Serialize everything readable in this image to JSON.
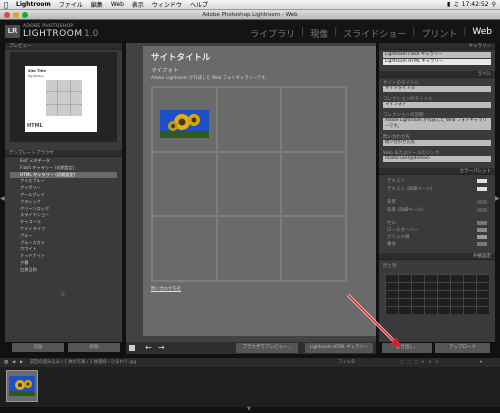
{
  "menubar": {
    "app": "Lightroom",
    "items": [
      "ファイル",
      "編集",
      "Web",
      "表示",
      "ウィンドウ",
      "ヘルプ"
    ],
    "time": "17:42:52"
  },
  "window": {
    "title": "Adobe Photoshop Lightroom - Web"
  },
  "identity": {
    "badge": "LR",
    "adobe": "ADOBE PHOTOSHOP",
    "name": "LIGHTROOM",
    "version": "1.0"
  },
  "modules": [
    "ライブラリ",
    "現像",
    "スライドショー",
    "プリント",
    "Web"
  ],
  "left": {
    "preview_header": "プレビュー",
    "preview_html": "HTML",
    "preview_title": "Site Title",
    "preview_sub": "My Photos",
    "templates_header": "テンプレートブラウザ",
    "templates": [
      "Exif メタデータ",
      "Flash ギャラリー (初期設定)",
      "HTML ギャラリー (初期設定)",
      "アイスブルー",
      "アイボリー",
      "アールグレイ",
      "クラシック",
      "グリーンロック",
      "スライドショー",
      "チャコール",
      "ナイトライフ",
      "ブルー",
      "ブルースカイ",
      "ホワイト",
      "ミッドナイト",
      "夕暮",
      "白黒日和"
    ],
    "selected_template": "HTML ギャラリー (初期設定)",
    "btn_preview": "追加",
    "btn_remove": "削除"
  },
  "center": {
    "site_title": "サイトタイトル",
    "collection_title": "マイフォト",
    "collection_desc": "Adobe Lightroom が作成した Web フォトギャラリーです。",
    "contact": "問い合わせ先名",
    "btn_browser": "ブラウザでプレビュー...",
    "gallery_select": "Lightroom HTML ギャラリー"
  },
  "right": {
    "gallery_header": "ギャラリー",
    "engines": [
      "Lightroom Flash ギャラリー",
      "Lightroom HTML ギャラリー"
    ],
    "labels_header": "ラベル",
    "fields": [
      {
        "label": "サイトのタイトル",
        "value": "サイトタイトル"
      },
      {
        "label": "コレクションのタイトル",
        "value": "マイフォト"
      },
      {
        "label": "コレクションの説明",
        "value": "Adobe Lightroom が作成した Web フォトギャラリーです。"
      },
      {
        "label": "問い合わせ先",
        "value": "問い合わせ先名"
      },
      {
        "label": "Web またはメールのリンク",
        "value": "mailto:user@domain"
      }
    ],
    "colors_header": "カラーパレット",
    "colors": [
      "テキスト",
      "テキスト (詳細ページ)",
      "背景",
      "背景 (詳細ページ)",
      "セル",
      "ロールオーバー",
      "グリッド線",
      "番号"
    ],
    "appearance_header": "外観設定",
    "layout_label": "行と列",
    "btn_export": "書き出し...",
    "btn_upload": "アップロード"
  },
  "filmstrip": {
    "info": "前回の読み込み / 1 枚の写真 / 1 枚選択 / ひまわり.jpg",
    "filter_label": "フィルタ"
  }
}
